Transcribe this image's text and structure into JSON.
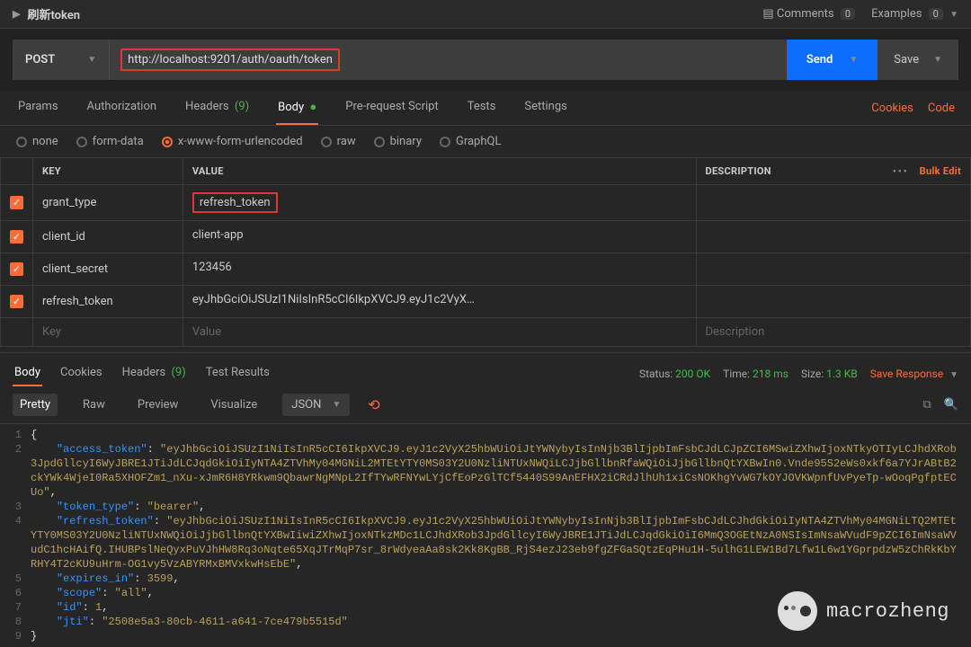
{
  "header": {
    "title": "刷新token",
    "comments_label": "Comments",
    "comments_count": "0",
    "examples_label": "Examples",
    "examples_count": "0"
  },
  "request": {
    "method": "POST",
    "url": "http://localhost:9201/auth/oauth/token",
    "send_label": "Send",
    "save_label": "Save"
  },
  "tabs": {
    "params": "Params",
    "authorization": "Authorization",
    "headers": "Headers",
    "headers_count": "(9)",
    "body": "Body",
    "prerequest": "Pre-request Script",
    "tests": "Tests",
    "settings": "Settings",
    "cookies": "Cookies",
    "code": "Code"
  },
  "body_types": {
    "none": "none",
    "formdata": "form-data",
    "urlencoded": "x-www-form-urlencoded",
    "raw": "raw",
    "binary": "binary",
    "graphql": "GraphQL"
  },
  "table": {
    "key_header": "KEY",
    "value_header": "VALUE",
    "desc_header": "DESCRIPTION",
    "bulk_edit": "Bulk Edit",
    "rows": [
      {
        "key": "grant_type",
        "value": "refresh_token",
        "highlight": true
      },
      {
        "key": "client_id",
        "value": "client-app",
        "highlight": false
      },
      {
        "key": "client_secret",
        "value": "123456",
        "highlight": false
      },
      {
        "key": "refresh_token",
        "value": "eyJhbGciOiJSUzI1NiIsInR5cCI6IkpXVCJ9.eyJ1c2VyX25hbWU...",
        "highlight": false
      }
    ],
    "key_ph": "Key",
    "value_ph": "Value",
    "desc_ph": "Description"
  },
  "response": {
    "tabs": {
      "body": "Body",
      "cookies": "Cookies",
      "headers": "Headers",
      "headers_count": "(9)",
      "tests": "Test Results"
    },
    "status_label": "Status:",
    "status_value": "200 OK",
    "time_label": "Time:",
    "time_value": "218 ms",
    "size_label": "Size:",
    "size_value": "1.3 KB",
    "save_response": "Save Response"
  },
  "viewer": {
    "pretty": "Pretty",
    "raw": "Raw",
    "preview": "Preview",
    "visualize": "Visualize",
    "format": "JSON"
  },
  "json_body": {
    "access_token": "eyJhbGciOiJSUzI1NiIsInR5cCI6IkpXVCJ9.eyJ1c2VyX25hbWUiOiJtYWNybyIsInNjb3BlIjpbImFsbCJdLCJpZCI6MSwiZXhwIjoxNTkyOTIyLCJhdXRob3JpdGllcyI6WyJBRE1JTiJdLCJqdGkiOiIyNTA4ZTVhMy04MGNiL2MTEtYTY0MS03Y2U0NzliNTUxNWQiLCJjbGllbnRfaWQiOiJjbGllbnQtYXBwIn0.Vnde95S2eWs0xkf6a7YJrABtB2ckYWk4WjeI0Ra5XHOFZm1_nXu-xJmR6H8YRkwm9QbawrNgMNpL2IfTYwRFNYwLYjCfEoPzGlTCf5440S99AnEFHX2iCRdJlhUh1xiCsNOKhgYvWG7kOYJOVKWpnfUvPyeTp-wOoqPgfptECUo",
    "token_type": "bearer",
    "refresh_token": "eyJhbGciOiJSUzI1NiIsInR5cCI6IkpXVCJ9.eyJ1c2VyX25hbWUiOiJtYWNybyIsInNjb3BlIjpbImFsbCJdLCJhdGkiOiIyNTA4ZTVhMy04MGNiLTQ2MTEtYTY0MS03Y2U0NzliNTUxNWQiOiJjbGllbnQtYXBwIiwiZXhwIjoxNTkzMDc1LCJhdXRob3JpdGllcyI6WyJBRE1JTiJdLCJqdGkiOiI6MmQ3OGEtNzA0NSIsImNsaWVudF9pZCI6ImNsaWVudC1hcHAifQ.IHUBPslNeQyxPuVJhHW8Rq3oNqte65XqJTrMqP7sr_8rWdyeaAa8sk2Kk8KgBB_RjS4ezJ23eb9fgZFGaSQtzEqPHu1H-5ulhG1LEW1Bd7Lfw1L6w1YGprpdzW5zChRkKbYRHY4T2cKU9uHrm-OG1vy5VzABYRMxBMVxkwHsEbE",
    "expires_in": "3599",
    "scope": "all",
    "id": "1",
    "jti": "2508e5a3-80cb-4611-a641-7ce479b5515d"
  },
  "watermark": "macrozheng"
}
